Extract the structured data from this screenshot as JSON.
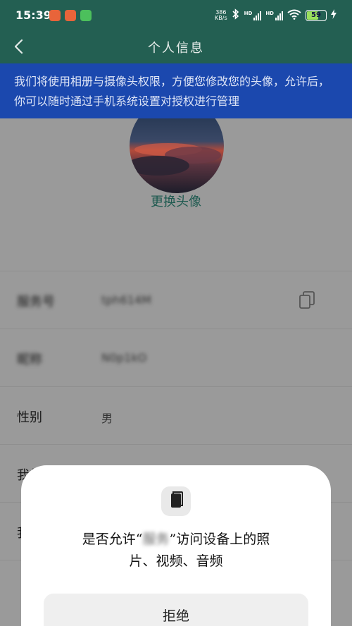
{
  "status_bar": {
    "time": "15:39",
    "net_speed_value": "386",
    "net_speed_unit": "KB/s",
    "signal_1_tag": "HD",
    "signal_2_tag": "HD",
    "battery_level": "59",
    "app_icon_colors": [
      "#e8643a",
      "#e8643a",
      "#4cc05c"
    ]
  },
  "nav": {
    "title": "个人信息",
    "back_icon": "chevron-left-icon"
  },
  "permission_banner": {
    "text": "我们将使用相册与摄像头权限，方便您修改您的头像，允许后，你可以随时通过手机系统设置对授权进行管理"
  },
  "profile": {
    "change_avatar_label": "更换头像",
    "rows": [
      {
        "label": "服务号",
        "value": "tph614M",
        "blurred": true
      },
      {
        "label": "昵称",
        "value": "N0p1kO",
        "blurred": true
      },
      {
        "label": "性别",
        "value": "男",
        "blurred": false
      },
      {
        "label": "我的",
        "value": "",
        "blurred": false
      },
      {
        "label": "我",
        "value": "",
        "blurred": false
      }
    ],
    "copy_icon": "copy-icon"
  },
  "permission_dialog": {
    "icon": "document-icon",
    "question_prefix": "是否允许“",
    "app_name": "服务",
    "question_suffix_line1": "”访问设备上的照",
    "question_line2": "片、视频、音频",
    "deny_label": "拒绝"
  },
  "colors": {
    "header": "#235f52",
    "banner": "#1b48ae",
    "accent_text": "#1e5a50",
    "dim_overlay": "#9a9a9a"
  }
}
